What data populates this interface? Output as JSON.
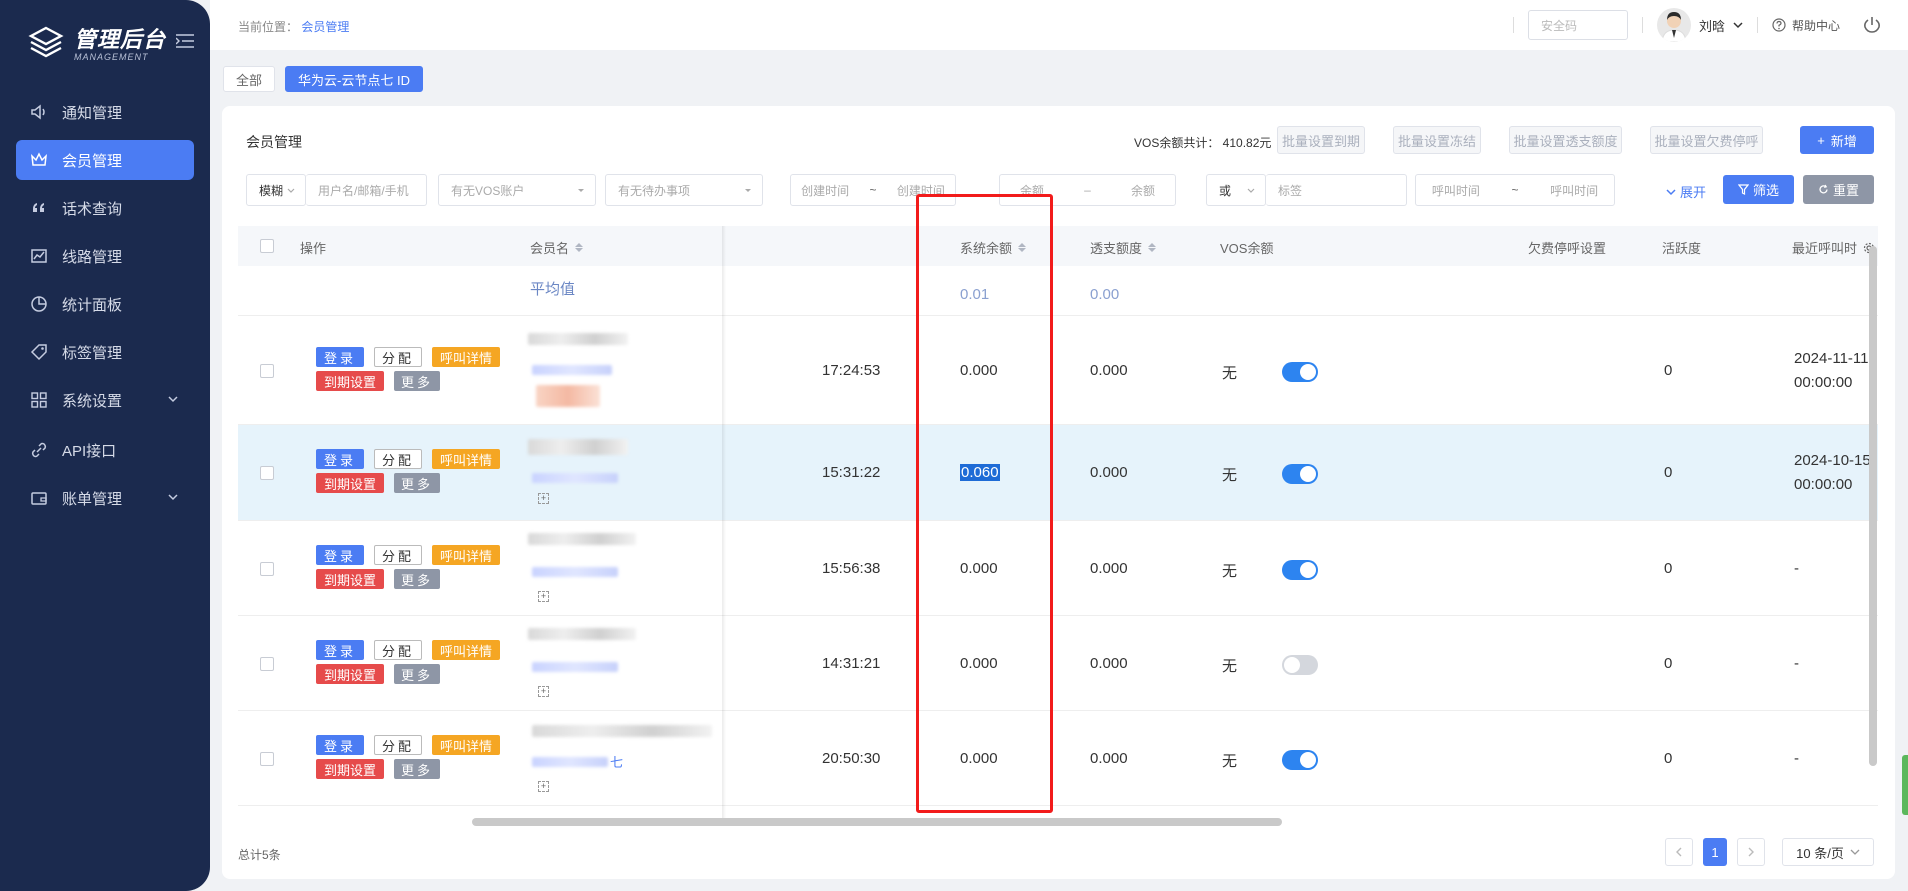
{
  "app": {
    "title": "管理后台",
    "subtitle": "MANAGEMENT"
  },
  "sidebar": {
    "items": [
      {
        "label": "通知管理",
        "icon": "speaker-icon",
        "active": false
      },
      {
        "label": "会员管理",
        "icon": "crown-icon",
        "active": true
      },
      {
        "label": "话术查询",
        "icon": "quote-icon",
        "active": false
      },
      {
        "label": "线路管理",
        "icon": "line-chart-icon",
        "active": false
      },
      {
        "label": "统计面板",
        "icon": "pie-chart-icon",
        "active": false
      },
      {
        "label": "标签管理",
        "icon": "tag-icon",
        "active": false
      },
      {
        "label": "系统设置",
        "icon": "grid-icon",
        "active": false,
        "has_children": true
      },
      {
        "label": "API接口",
        "icon": "link-icon",
        "active": false
      },
      {
        "label": "账单管理",
        "icon": "wallet-icon",
        "active": false,
        "has_children": true
      }
    ]
  },
  "header": {
    "breadcrumb_prefix": "当前位置：",
    "breadcrumb_current": "会员管理",
    "security_placeholder": "安全码",
    "user_name": "刘晗",
    "help_label": "帮助中心"
  },
  "tags": {
    "all": "全部",
    "current": "华为云-云节点七  ID"
  },
  "panel": {
    "title": "会员管理",
    "vos_total": "VOS余额共计：  410.82元",
    "batch_buttons": [
      "批量设置到期",
      "批量设置冻结",
      "批量设置透支额度",
      "批量设置欠费停呼"
    ],
    "add_label": "新增"
  },
  "filters": {
    "mode": "模糊",
    "user_placeholder": "用户名/邮箱/手机",
    "vos_account": "有无VOS账户",
    "todo": "有无待办事项",
    "created_from": "创建时间",
    "created_to": "创建时间",
    "range_sep": "~",
    "balance_from": "余额",
    "balance_to": "余额",
    "balance_sep": "–",
    "logic": "或",
    "tag_placeholder": "标签",
    "call_from": "呼叫时间",
    "call_to": "呼叫时间",
    "expand_label": "展开",
    "filter_label": "筛选",
    "reset_label": "重置"
  },
  "table": {
    "columns": {
      "ops": "操作",
      "member": "会员名",
      "sys_balance": "系统余额",
      "overdraft": "透支额度",
      "vos_balance": "VOS余额",
      "stop_call": "欠费停呼设置",
      "activity": "活跃度",
      "last_call": "最近呼叫时"
    },
    "average": {
      "label": "平均值",
      "sys_balance": "0.01",
      "overdraft": "0.00"
    },
    "op_labels": {
      "login": "登录",
      "assign": "分配",
      "call_detail": "呼叫详情",
      "expire": "到期设置",
      "more": "更多"
    },
    "rows": [
      {
        "time": "17:24:53",
        "sys_balance": "0.000",
        "overdraft": "0.000",
        "vos": "无",
        "stop_call": true,
        "activity": "0",
        "last_call_date": "2024-11-11",
        "last_call_time": "00:00:00",
        "member_suffix": ""
      },
      {
        "time": "15:31:22",
        "sys_balance": "0.060",
        "overdraft": "0.000",
        "vos": "无",
        "stop_call": true,
        "activity": "0",
        "last_call_date": "2024-10-15",
        "last_call_time": "00:00:00",
        "member_suffix": ""
      },
      {
        "time": "15:56:38",
        "sys_balance": "0.000",
        "overdraft": "0.000",
        "vos": "无",
        "stop_call": true,
        "activity": "0",
        "last_call_date": "-",
        "last_call_time": "",
        "member_suffix": ""
      },
      {
        "time": "14:31:21",
        "sys_balance": "0.000",
        "overdraft": "0.000",
        "vos": "无",
        "stop_call": false,
        "activity": "0",
        "last_call_date": "-",
        "last_call_time": "",
        "member_suffix": ""
      },
      {
        "time": "20:50:30",
        "sys_balance": "0.000",
        "overdraft": "0.000",
        "vos": "无",
        "stop_call": true,
        "activity": "0",
        "last_call_date": "-",
        "last_call_time": "",
        "member_suffix": "七"
      }
    ]
  },
  "footer": {
    "total": "总计5条",
    "page": "1",
    "page_size": "10 条/页"
  },
  "colors": {
    "sidebar_bg": "#1b2a4e",
    "accent": "#4b7cf3",
    "highlight_box": "#f21b1b"
  }
}
